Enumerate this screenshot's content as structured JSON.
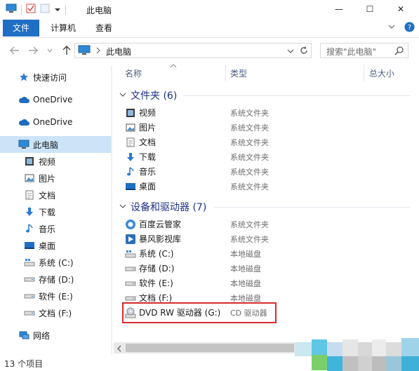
{
  "window": {
    "title": "此电脑",
    "minimize": "—",
    "maximize": "☐",
    "close": "✕"
  },
  "ribbon": {
    "tabs": [
      "文件",
      "计算机",
      "查看"
    ]
  },
  "address": {
    "path": "此电脑",
    "search_placeholder": "搜索\"此电脑\""
  },
  "sidebar": {
    "items": [
      {
        "label": "快速访问",
        "icon": "star-icon"
      },
      {
        "label": "OneDrive",
        "icon": "cloud-icon"
      },
      {
        "label": "OneDrive",
        "icon": "cloud-icon"
      },
      {
        "label": "此电脑",
        "icon": "computer-icon"
      },
      {
        "label": "视频",
        "icon": "video-icon"
      },
      {
        "label": "图片",
        "icon": "picture-icon"
      },
      {
        "label": "文档",
        "icon": "document-icon"
      },
      {
        "label": "下载",
        "icon": "download-icon"
      },
      {
        "label": "音乐",
        "icon": "music-icon"
      },
      {
        "label": "桌面",
        "icon": "desktop-icon"
      },
      {
        "label": "系统 (C:)",
        "icon": "drive-icon"
      },
      {
        "label": "存储 (D:)",
        "icon": "drive-icon"
      },
      {
        "label": "软件 (E:)",
        "icon": "drive-icon"
      },
      {
        "label": "文档 (F:)",
        "icon": "drive-icon"
      },
      {
        "label": "网络",
        "icon": "network-icon"
      }
    ]
  },
  "columns": {
    "name": "名称",
    "type": "类型",
    "size": "总大小"
  },
  "folders": {
    "title": "文件夹 (6)",
    "items": [
      {
        "name": "视频",
        "type": "系统文件夹",
        "icon": "video-icon"
      },
      {
        "name": "图片",
        "type": "系统文件夹",
        "icon": "picture-icon"
      },
      {
        "name": "文档",
        "type": "系统文件夹",
        "icon": "document-icon"
      },
      {
        "name": "下载",
        "type": "系统文件夹",
        "icon": "download-icon"
      },
      {
        "name": "音乐",
        "type": "系统文件夹",
        "icon": "music-icon"
      },
      {
        "name": "桌面",
        "type": "系统文件夹",
        "icon": "desktop-icon"
      }
    ]
  },
  "devices": {
    "title": "设备和驱动器 (7)",
    "items": [
      {
        "name": "百度云管家",
        "type": "系统文件夹",
        "icon": "baidu-cloud-icon"
      },
      {
        "name": "暴风影视库",
        "type": "系统文件夹",
        "icon": "media-library-icon"
      },
      {
        "name": "系统 (C:)",
        "type": "本地磁盘",
        "icon": "windows-drive-icon"
      },
      {
        "name": "存储 (D:)",
        "type": "本地磁盘",
        "icon": "drive-icon"
      },
      {
        "name": "软件 (E:)",
        "type": "本地磁盘",
        "icon": "drive-icon"
      },
      {
        "name": "文档 (F:)",
        "type": "本地磁盘",
        "icon": "drive-icon"
      },
      {
        "name": "DVD RW 驱动器 (G:)",
        "type": "CD 驱动器",
        "icon": "dvd-drive-icon"
      }
    ]
  },
  "status": {
    "count": "13 个项目"
  },
  "colors": {
    "accent": "#1f6fc4",
    "group_title": "#1e3287",
    "selected": "#cce4f7",
    "highlight_border": "#d62b2b"
  }
}
